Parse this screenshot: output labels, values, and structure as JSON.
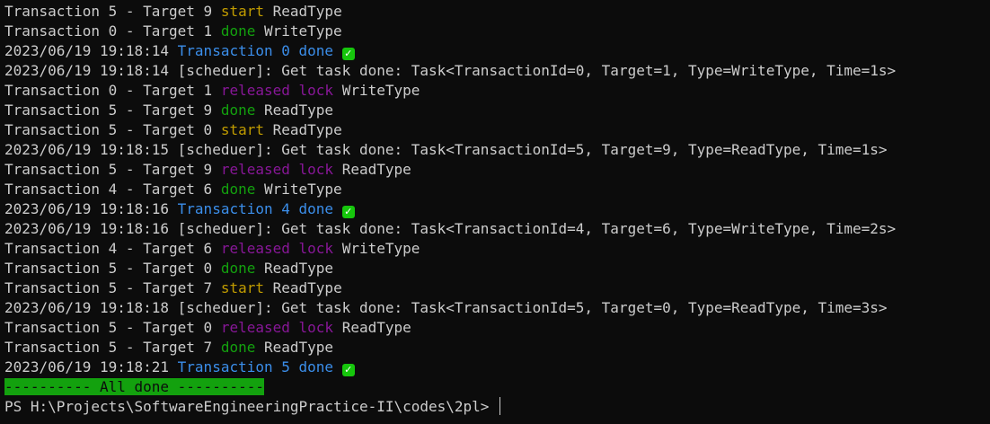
{
  "colors": {
    "background": "#0c0c0c",
    "default_text": "#cccccc",
    "start": "#c19c00",
    "done": "#13a10e",
    "transaction_done": "#3b8eea",
    "released_lock": "#881798",
    "banner_bg": "#13a10e",
    "check_bg": "#16c60c"
  },
  "lines": [
    {
      "type": "event",
      "prefix": "Transaction 5 - Target 9 ",
      "event": "start",
      "color": "yellow",
      "suffix": " ReadType"
    },
    {
      "type": "event",
      "prefix": "Transaction 0 - Target 1 ",
      "event": "done",
      "color": "green",
      "suffix": " WriteType"
    },
    {
      "type": "tx_done",
      "timestamp": "2023/06/19 19:18:14 ",
      "text": "Transaction 0 done",
      "icon": "check-mark-icon"
    },
    {
      "type": "log",
      "text": "2023/06/19 19:18:14 [scheduer]: Get task done: Task<TransactionId=0, Target=1, Type=WriteType, Time=1s>"
    },
    {
      "type": "event",
      "prefix": "Transaction 0 - Target 1 ",
      "event": "released lock",
      "color": "purple",
      "suffix": " WriteType"
    },
    {
      "type": "event",
      "prefix": "Transaction 5 - Target 9 ",
      "event": "done",
      "color": "green",
      "suffix": " ReadType"
    },
    {
      "type": "event",
      "prefix": "Transaction 5 - Target 0 ",
      "event": "start",
      "color": "yellow",
      "suffix": " ReadType"
    },
    {
      "type": "log",
      "text": "2023/06/19 19:18:15 [scheduer]: Get task done: Task<TransactionId=5, Target=9, Type=ReadType, Time=1s>"
    },
    {
      "type": "event",
      "prefix": "Transaction 5 - Target 9 ",
      "event": "released lock",
      "color": "purple",
      "suffix": " ReadType"
    },
    {
      "type": "event",
      "prefix": "Transaction 4 - Target 6 ",
      "event": "done",
      "color": "green",
      "suffix": " WriteType"
    },
    {
      "type": "tx_done",
      "timestamp": "2023/06/19 19:18:16 ",
      "text": "Transaction 4 done",
      "icon": "check-mark-icon"
    },
    {
      "type": "log",
      "text": "2023/06/19 19:18:16 [scheduer]: Get task done: Task<TransactionId=4, Target=6, Type=WriteType, Time=2s>"
    },
    {
      "type": "event",
      "prefix": "Transaction 4 - Target 6 ",
      "event": "released lock",
      "color": "purple",
      "suffix": " WriteType"
    },
    {
      "type": "event",
      "prefix": "Transaction 5 - Target 0 ",
      "event": "done",
      "color": "green",
      "suffix": " ReadType"
    },
    {
      "type": "event",
      "prefix": "Transaction 5 - Target 7 ",
      "event": "start",
      "color": "yellow",
      "suffix": " ReadType"
    },
    {
      "type": "log",
      "text": "2023/06/19 19:18:18 [scheduer]: Get task done: Task<TransactionId=5, Target=0, Type=ReadType, Time=3s>"
    },
    {
      "type": "event",
      "prefix": "Transaction 5 - Target 0 ",
      "event": "released lock",
      "color": "purple",
      "suffix": " ReadType"
    },
    {
      "type": "event",
      "prefix": "Transaction 5 - Target 7 ",
      "event": "done",
      "color": "green",
      "suffix": " ReadType"
    },
    {
      "type": "tx_done",
      "timestamp": "2023/06/19 19:18:21 ",
      "text": "Transaction 5 done",
      "icon": "check-mark-icon"
    },
    {
      "type": "banner",
      "text": "---------- All done ----------"
    },
    {
      "type": "prompt",
      "text": "PS H:\\Projects\\SoftwareEngineeringPractice-II\\codes\\2pl> "
    }
  ]
}
